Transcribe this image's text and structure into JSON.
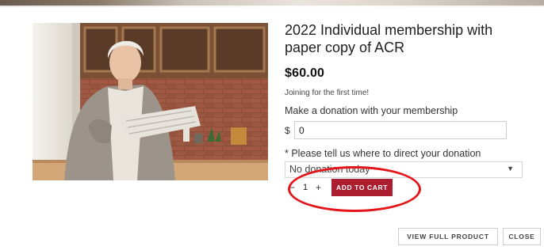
{
  "product": {
    "title": "2022 Individual membership with paper copy of ACR",
    "price": "$60.00",
    "note": "Joining for the first time!"
  },
  "donation": {
    "label": "Make a donation with your membership",
    "currency": "$",
    "value": "0"
  },
  "direct": {
    "label": "* Please tell us where to direct your donation",
    "selected": "No donation today"
  },
  "cart": {
    "minus": "−",
    "quantity": "1",
    "plus": "+",
    "add_label": "ADD TO CART"
  },
  "footer": {
    "view_full_label": "VIEW FULL PRODUCT",
    "close_label": "CLOSE"
  },
  "icons": {
    "dropdown": "chevron-down-icon"
  },
  "colors": {
    "accent": "#ac1e2f",
    "annotation": "#e3151b"
  }
}
